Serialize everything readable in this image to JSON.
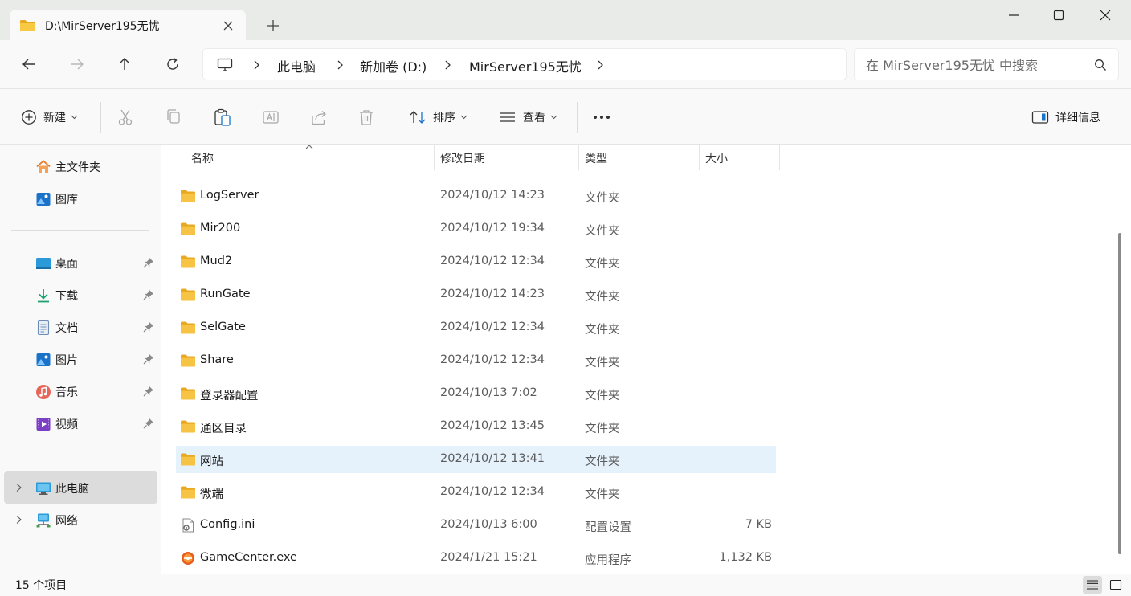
{
  "window": {
    "tab_title": "D:\\MirServer195无忧",
    "accent": "#0067c0",
    "folder_color": "#f6c344"
  },
  "breadcrumb": {
    "items": [
      "此电脑",
      "新加卷 (D:)",
      "MirServer195无忧"
    ]
  },
  "search": {
    "placeholder": "在 MirServer195无忧 中搜索"
  },
  "toolbar": {
    "new_label": "新建",
    "sort_label": "排序",
    "view_label": "查看",
    "details_label": "详细信息",
    "icons": [
      "cut-icon",
      "copy-icon",
      "paste-icon",
      "rename-icon",
      "share-icon",
      "delete-icon",
      "more-icon"
    ]
  },
  "sidebar": {
    "top": [
      {
        "label": "主文件夹",
        "icon": "home-icon"
      },
      {
        "label": "图库",
        "icon": "gallery-icon"
      }
    ],
    "pinned": [
      {
        "label": "桌面",
        "icon": "desktop-icon"
      },
      {
        "label": "下载",
        "icon": "download-icon"
      },
      {
        "label": "文档",
        "icon": "document-icon"
      },
      {
        "label": "图片",
        "icon": "pictures-icon"
      },
      {
        "label": "音乐",
        "icon": "music-icon"
      },
      {
        "label": "视频",
        "icon": "video-icon"
      }
    ],
    "bottom": [
      {
        "label": "此电脑",
        "icon": "computer-icon",
        "selected": true
      },
      {
        "label": "网络",
        "icon": "network-icon",
        "selected": false
      }
    ]
  },
  "columns": {
    "name": "名称",
    "modified": "修改日期",
    "type": "类型",
    "size": "大小"
  },
  "files": [
    {
      "name": "LogServer",
      "modified": "2024/10/12 14:23",
      "type": "文件夹",
      "size": "",
      "kind": "folder"
    },
    {
      "name": "Mir200",
      "modified": "2024/10/12 19:34",
      "type": "文件夹",
      "size": "",
      "kind": "folder"
    },
    {
      "name": "Mud2",
      "modified": "2024/10/12 12:34",
      "type": "文件夹",
      "size": "",
      "kind": "folder"
    },
    {
      "name": "RunGate",
      "modified": "2024/10/12 14:23",
      "type": "文件夹",
      "size": "",
      "kind": "folder"
    },
    {
      "name": "SelGate",
      "modified": "2024/10/12 12:34",
      "type": "文件夹",
      "size": "",
      "kind": "folder"
    },
    {
      "name": "Share",
      "modified": "2024/10/12 12:34",
      "type": "文件夹",
      "size": "",
      "kind": "folder"
    },
    {
      "name": "登录器配置",
      "modified": "2024/10/13 7:02",
      "type": "文件夹",
      "size": "",
      "kind": "folder"
    },
    {
      "name": "通区目录",
      "modified": "2024/10/12 13:45",
      "type": "文件夹",
      "size": "",
      "kind": "folder"
    },
    {
      "name": "网站",
      "modified": "2024/10/12 13:41",
      "type": "文件夹",
      "size": "",
      "kind": "folder",
      "selected": true
    },
    {
      "name": "微端",
      "modified": "2024/10/12 12:34",
      "type": "文件夹",
      "size": "",
      "kind": "folder"
    },
    {
      "name": "Config.ini",
      "modified": "2024/10/13 6:00",
      "type": "配置设置",
      "size": "7 KB",
      "kind": "ini"
    },
    {
      "name": "GameCenter.exe",
      "modified": "2024/1/21 15:21",
      "type": "应用程序",
      "size": "1,132 KB",
      "kind": "exe"
    }
  ],
  "status": {
    "count": "15 个项目"
  }
}
